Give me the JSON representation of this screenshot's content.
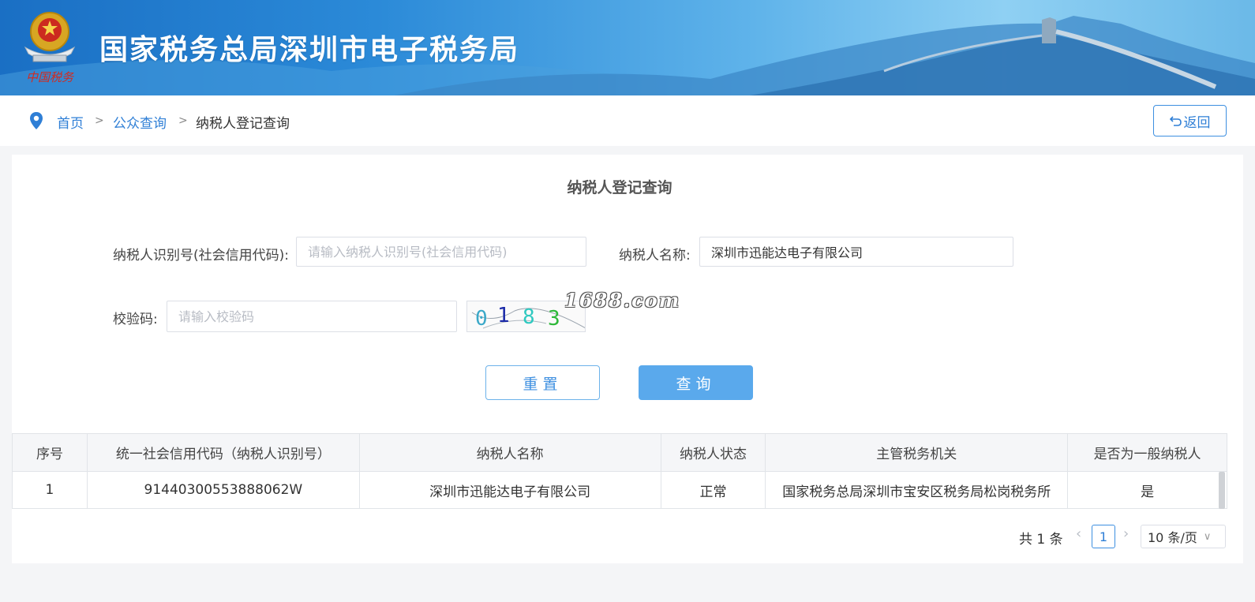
{
  "header": {
    "title": "国家税务总局深圳市电子税务局",
    "emblem_caption": "中国税务"
  },
  "breadcrumb": {
    "items": [
      "首页",
      "公众查询",
      "纳税人登记查询"
    ],
    "separator": ">"
  },
  "back_button": {
    "label": "返回",
    "icon": "undo-arrow-icon"
  },
  "form": {
    "title": "纳税人登记查询",
    "taxpayer_id": {
      "label": "纳税人识别号(社会信用代码):",
      "value": "",
      "placeholder": "请输入纳税人识别号(社会信用代码)"
    },
    "taxpayer_name": {
      "label": "纳税人名称:",
      "value": "深圳市迅能达电子有限公司",
      "placeholder": ""
    },
    "captcha": {
      "label": "校验码:",
      "value": "",
      "placeholder": "请输入校验码",
      "image_text": [
        "0",
        "1",
        "8",
        "3"
      ]
    },
    "reset_label": "重置",
    "query_label": "查询"
  },
  "watermark": "1688.com",
  "table": {
    "columns": [
      "序号",
      "统一社会信用代码（纳税人识别号）",
      "纳税人名称",
      "纳税人状态",
      "主管税务机关",
      "是否为一般纳税人"
    ],
    "rows": [
      [
        "1",
        "91440300553888062W",
        "深圳市迅能达电子有限公司",
        "正常",
        "国家税务总局深圳市宝安区税务局松岗税务所",
        "是"
      ]
    ]
  },
  "pagination": {
    "total": "共 1 条",
    "current_page": "1",
    "page_size": "10 条/页"
  },
  "colors": {
    "accent": "#2f7fd6",
    "query_button": "#5aa9ec",
    "banner": "#2b8ad8"
  }
}
